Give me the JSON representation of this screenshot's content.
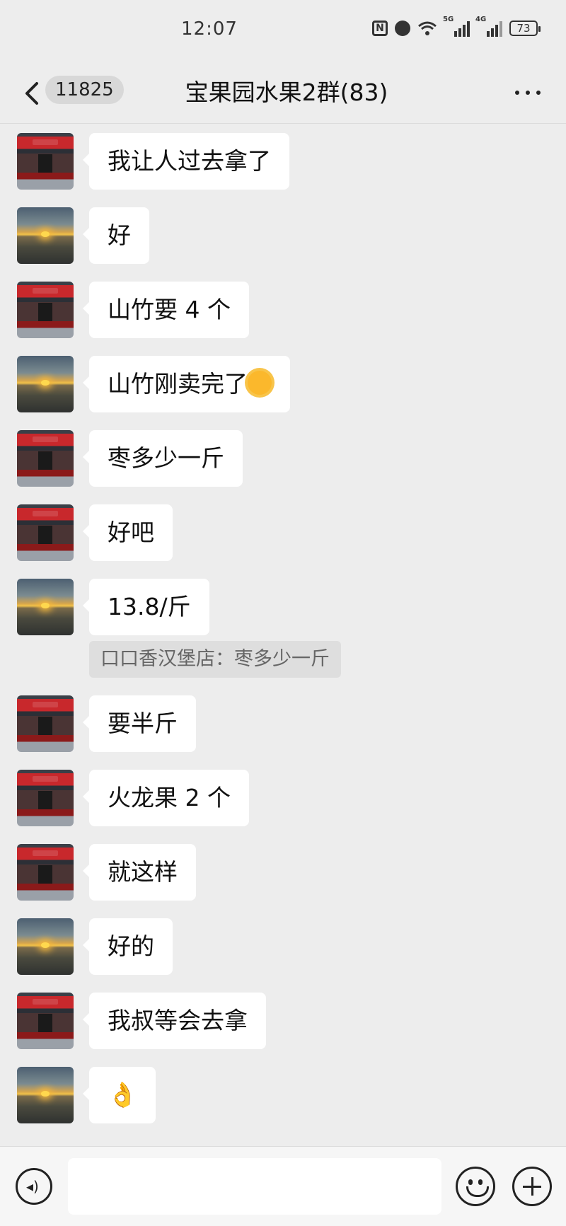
{
  "status_bar": {
    "time": "12:07",
    "signal1_label": "5G",
    "signal2_label": "4G",
    "battery": "73"
  },
  "header": {
    "unread_count": "11825",
    "title": "宝果园水果2群(83)"
  },
  "messages": [
    {
      "sender": "shop",
      "text": "我让人过去拿了"
    },
    {
      "sender": "sunset",
      "text": "好"
    },
    {
      "sender": "shop",
      "text": "山竹要 4 个"
    },
    {
      "sender": "sunset",
      "text": "山竹刚卖完了"
    },
    {
      "sender": "shop",
      "text": "枣多少一斤"
    },
    {
      "sender": "shop",
      "text": "好吧"
    },
    {
      "sender": "sunset",
      "text": "13.8/斤",
      "quote": "口口香汉堡店：枣多少一斤"
    },
    {
      "sender": "shop",
      "text": "要半斤"
    },
    {
      "sender": "shop",
      "text": "火龙果 2 个"
    },
    {
      "sender": "shop",
      "text": "就这样"
    },
    {
      "sender": "sunset",
      "text": "好的"
    },
    {
      "sender": "shop",
      "text": "我叔等会去拿"
    },
    {
      "sender": "sunset",
      "text": "👌"
    }
  ],
  "input": {
    "value": ""
  }
}
